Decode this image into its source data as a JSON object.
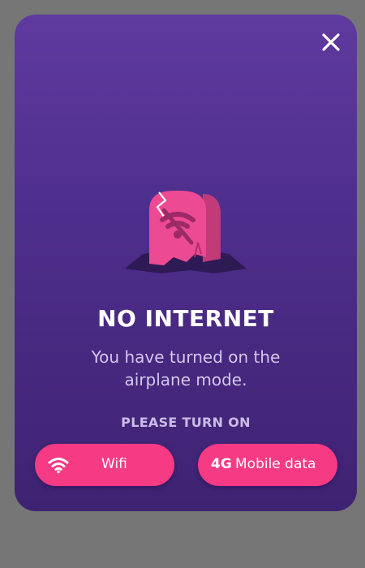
{
  "modal": {
    "title": "NO INTERNET",
    "message": "You have turned on the airplane mode.",
    "subtitle": "PLEASE TURN ON",
    "close_icon": "close-icon",
    "illustration": "broken-tombstone-wifi-off-icon"
  },
  "buttons": {
    "wifi": {
      "icon": "wifi-icon",
      "label": "Wifi"
    },
    "mobile": {
      "icon_text": "4G",
      "label": "Mobile data"
    }
  },
  "colors": {
    "overlay": "#767676",
    "modal_top": "#5f3a9f",
    "modal_bottom": "#3e2372",
    "accent": "#f63a83",
    "title": "#ffffff",
    "message": "#d5c7ee"
  }
}
